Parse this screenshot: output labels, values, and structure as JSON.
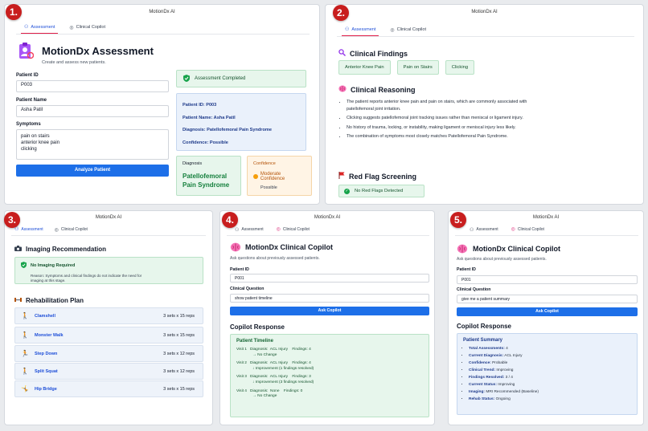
{
  "app_title": "MotionDx AI",
  "badges": [
    "1.",
    "2.",
    "3.",
    "4.",
    "5."
  ],
  "tabs": {
    "assessment": "Assessment",
    "copilot": "Clinical Copilot"
  },
  "p1": {
    "title": "MotionDx Assessment",
    "subtitle": "Create and assess new patients.",
    "patient_id_label": "Patient ID",
    "patient_id_value": "P003",
    "patient_name_label": "Patient Name",
    "patient_name_value": "Asha Patil",
    "symptoms_label": "Symptoms",
    "symptoms_lines": [
      "pain on stairs",
      "anterior knee pain",
      "clicking"
    ],
    "analyze_button": "Analyze Patient",
    "completed": "Assessment Completed",
    "info": {
      "id": "Patient ID: P003",
      "name": "Patient Name: Asha Patil",
      "diagnosis": "Diagnosis: Patellofemoral Pain Syndrome",
      "confidence": "Confidence: Possible"
    },
    "diag_card": {
      "label": "Diagnosis",
      "value_line1": "Patellofemoral",
      "value_line2": "Pain Syndrome"
    },
    "conf_card": {
      "label": "Confidence",
      "value": "Moderate Confidence",
      "sub": "Possible"
    }
  },
  "p2": {
    "findings_title": "Clinical Findings",
    "findings": [
      "Anterior Knee Pain",
      "Pain on Stairs",
      "Clicking"
    ],
    "reasoning_title": "Clinical Reasoning",
    "reasoning": [
      "The patient reports anterior knee pain and pain on stairs, which are commonly associated with patellofemoral joint irritation.",
      "Clicking suggests patellofemoral joint tracking issues rather than meniscal or ligament injury.",
      "No history of trauma, locking, or instability, making ligament or meniscal injury less likely.",
      "The combination of symptoms most closely matches Patellofemoral Pain Syndrome."
    ],
    "redflag_title": "Red Flag Screening",
    "redflag_status": "No Red Flags Detected"
  },
  "p3": {
    "imaging_title": "Imaging Recommendation",
    "imaging_status": "No Imaging Required",
    "imaging_reason_1": "Reason: Symptoms and clinical findings do not indicate the need for",
    "imaging_reason_2": "imaging at this stage.",
    "rehab_title": "Rehabilitation Plan",
    "exercises": [
      {
        "name": "Clamshell",
        "reps": "3 sets x 15 reps"
      },
      {
        "name": "Monster Walk",
        "reps": "3 sets x 15 reps"
      },
      {
        "name": "Step Down",
        "reps": "3 sets x 12 reps"
      },
      {
        "name": "Split Squat",
        "reps": "3 sets x 12 reps"
      },
      {
        "name": "Hip Bridge",
        "reps": "3 sets x 15 reps"
      }
    ]
  },
  "copilot": {
    "title": "MotionDx Clinical Copilot",
    "subtitle": "Ask questions about previously assessed patients.",
    "patient_id_label": "Patient ID",
    "question_label": "Clinical Question",
    "ask_button": "Ask Copilot",
    "response_title": "Copilot Response"
  },
  "p4": {
    "patient_id": "P001",
    "question": "show patient timeline",
    "timeline_title": "Patient Timeline",
    "visits": [
      {
        "line1": "Visit 1   Diagnosis:  ACL Injury    Findings: 4",
        "line2": "→ No Change"
      },
      {
        "line1": "Visit 2   Diagnosis:  ACL Injury    Findings: 4",
        "line2": "↓ Improvement (1 findings resolved)"
      },
      {
        "line1": "Visit 3   Diagnosis:  ACL Injury    Findings: 3",
        "line2": "↓ Improvement (3 findings resolved)"
      },
      {
        "line1": "Visit 4   Diagnosis:  None    Findings: 0",
        "line2": "→ No Change"
      }
    ]
  },
  "p5": {
    "patient_id": "P001",
    "question": "give me a patient summary",
    "summary_title": "Patient Summary",
    "summary": [
      {
        "k": "Total Assessments:",
        "v": "4"
      },
      {
        "k": "Current Diagnosis:",
        "v": "ACL Injury"
      },
      {
        "k": "Confidence:",
        "v": "Probable"
      },
      {
        "k": "Clinical Trend:",
        "v": "Improving"
      },
      {
        "k": "Findings Resolved:",
        "v": "3 / 4"
      },
      {
        "k": "Current Status:",
        "v": "Improving"
      },
      {
        "k": "Imaging:",
        "v": "MRI Recommended (Baseline)"
      },
      {
        "k": "Rehab Status:",
        "v": "Ongoing"
      }
    ]
  },
  "icons": {
    "app": "clipboard-person-icon",
    "findings": "magnifier-icon",
    "reasoning": "brain-icon",
    "redflag": "red-flag-icon",
    "imaging": "camera-icon",
    "rehab": "dumbbell-icon"
  }
}
